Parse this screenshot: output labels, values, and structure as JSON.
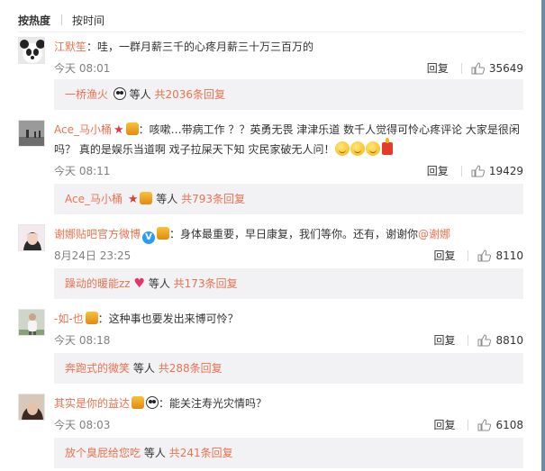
{
  "sort": {
    "hot": "按热度",
    "time": "按时间"
  },
  "labels": {
    "reply": "回复",
    "etc": "等人"
  },
  "comments": [
    {
      "user": "江默笙",
      "text": "：哇，一群月薪三千的心疼月薪三十万三百万的",
      "time": "今天 08:01",
      "likes": "35649",
      "sub_user": "一桥渔火",
      "sub_count": "共2036条回复"
    },
    {
      "user": "Ace_马小桶",
      "text": "：咳嗽…带病工作 ？？英勇无畏 津津乐道 数千人觉得可怜心疼评论  大家是很闲吗？ 真的是娱乐当道啊  戏子拉屎天下知 灾民家破无人问！",
      "time": "今天 08:11",
      "likes": "19429",
      "sub_user": "Ace_马小桶",
      "sub_count": "共793条回复"
    },
    {
      "user": "谢娜贴吧官方微博",
      "text": "：身体最重要，早日康复，我们等你。还有，谢谢你",
      "mention": "@谢娜",
      "time": "8月24日 23:25",
      "likes": "8110",
      "sub_user": "躁动的暖能zz",
      "sub_count": "共173条回复"
    },
    {
      "user": "-如-也",
      "text": "：这种事也要发出来博可怜？",
      "time": "今天 08:18",
      "likes": "8810",
      "sub_user": "奔跑式的微笑",
      "sub_count": "共288条回复"
    },
    {
      "user": "其实是你的益达",
      "text": "：能关注寿光灾情吗？",
      "time": "今天 08:03",
      "likes": "6108",
      "sub_user": "放个臭屁给您吃",
      "sub_count": "共241条回复"
    }
  ]
}
